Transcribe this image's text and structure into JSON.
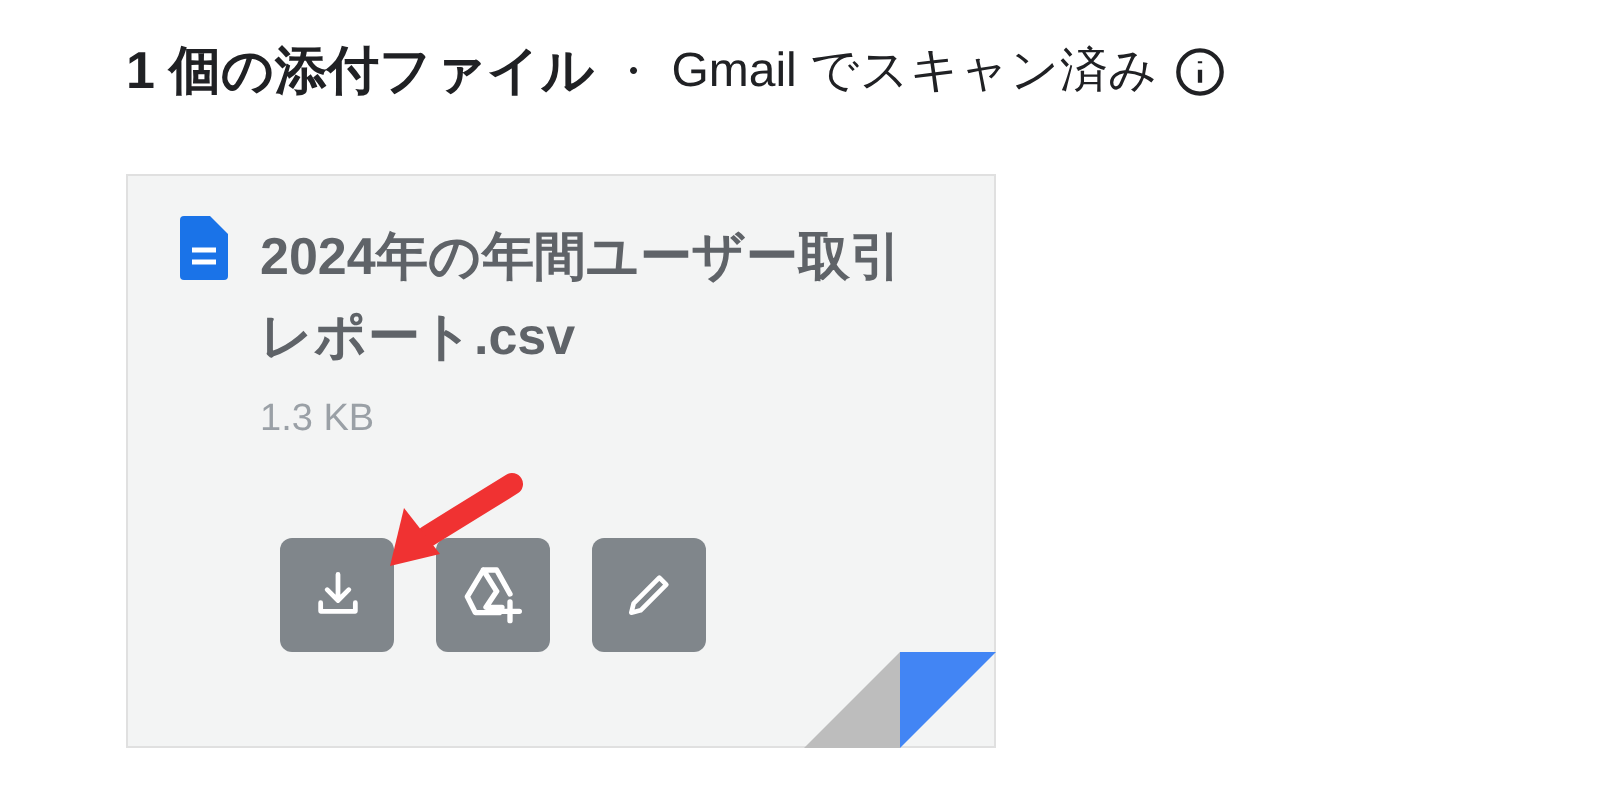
{
  "header": {
    "title": "1 個の添付ファイル",
    "separator": "・",
    "scan_note": "Gmail でスキャン済み"
  },
  "attachment": {
    "name": "2024年の年間ユーザー取引レポート.csv",
    "size": "1.3 KB",
    "actions": [
      {
        "kind": "download",
        "highlighted": true
      },
      {
        "kind": "drive"
      },
      {
        "kind": "edit"
      }
    ]
  }
}
